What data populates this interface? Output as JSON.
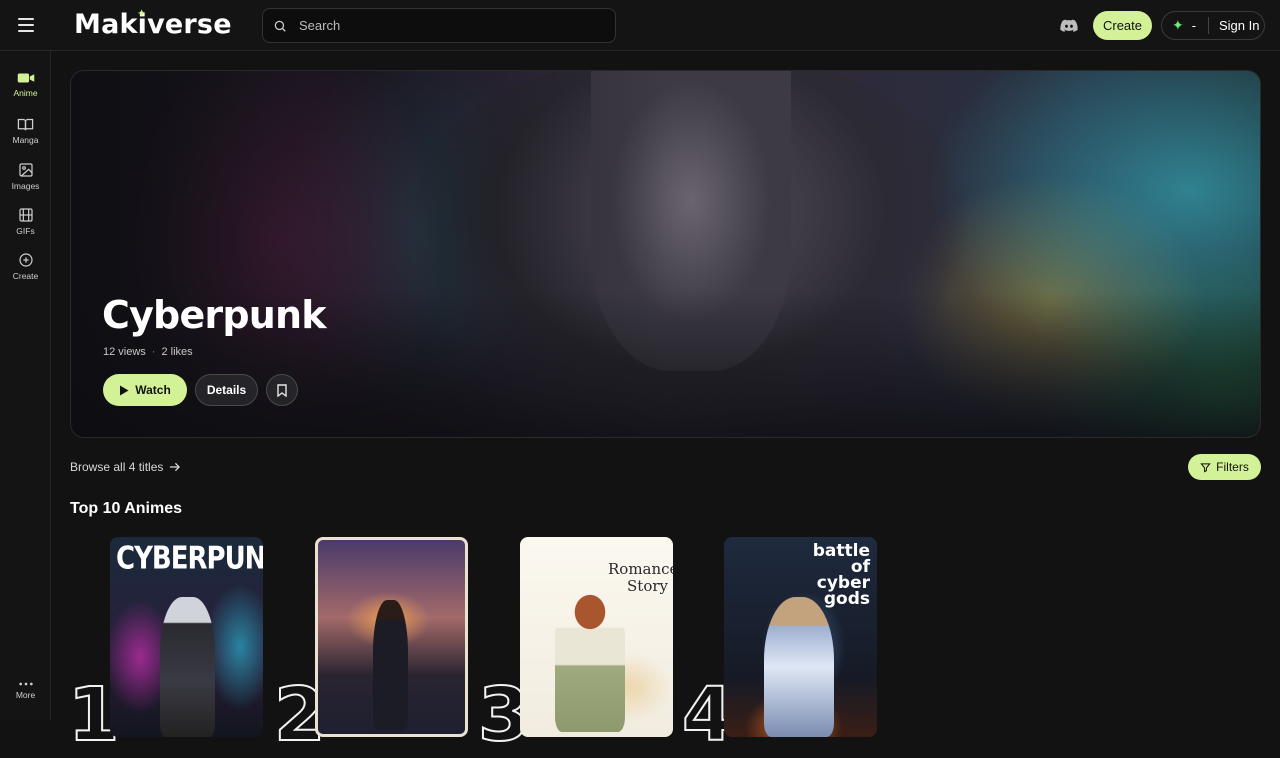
{
  "header": {
    "logo": "Makiverse",
    "search_placeholder": "Search",
    "create_label": "Create",
    "credits_value": "-",
    "signin_label": "Sign In"
  },
  "sidebar": {
    "items": [
      {
        "label": "Anime",
        "icon": "video-camera-icon",
        "active": true
      },
      {
        "label": "Manga",
        "icon": "book-open-icon",
        "active": false
      },
      {
        "label": "Images",
        "icon": "image-icon",
        "active": false
      },
      {
        "label": "GIFs",
        "icon": "film-icon",
        "active": false
      },
      {
        "label": "Create",
        "icon": "plus-circle-icon",
        "active": false
      }
    ],
    "more_label": "More"
  },
  "hero": {
    "title": "Cyberpunk",
    "views": "12 views",
    "likes": "2 likes",
    "watch_label": "Watch",
    "details_label": "Details"
  },
  "browse": {
    "label": "Browse all 4 titles",
    "filters_label": "Filters"
  },
  "top10": {
    "title": "Top 10 Animes",
    "items": [
      {
        "rank": "1",
        "cover_text": "CYBERPUNK"
      },
      {
        "rank": "2",
        "cover_text": ""
      },
      {
        "rank": "3",
        "cover_text": "Romance Story"
      },
      {
        "rank": "4",
        "cover_text": "battle of cyber gods"
      }
    ]
  },
  "colors": {
    "accent": "#d3f197",
    "background": "#121212",
    "panel": "#141414"
  }
}
